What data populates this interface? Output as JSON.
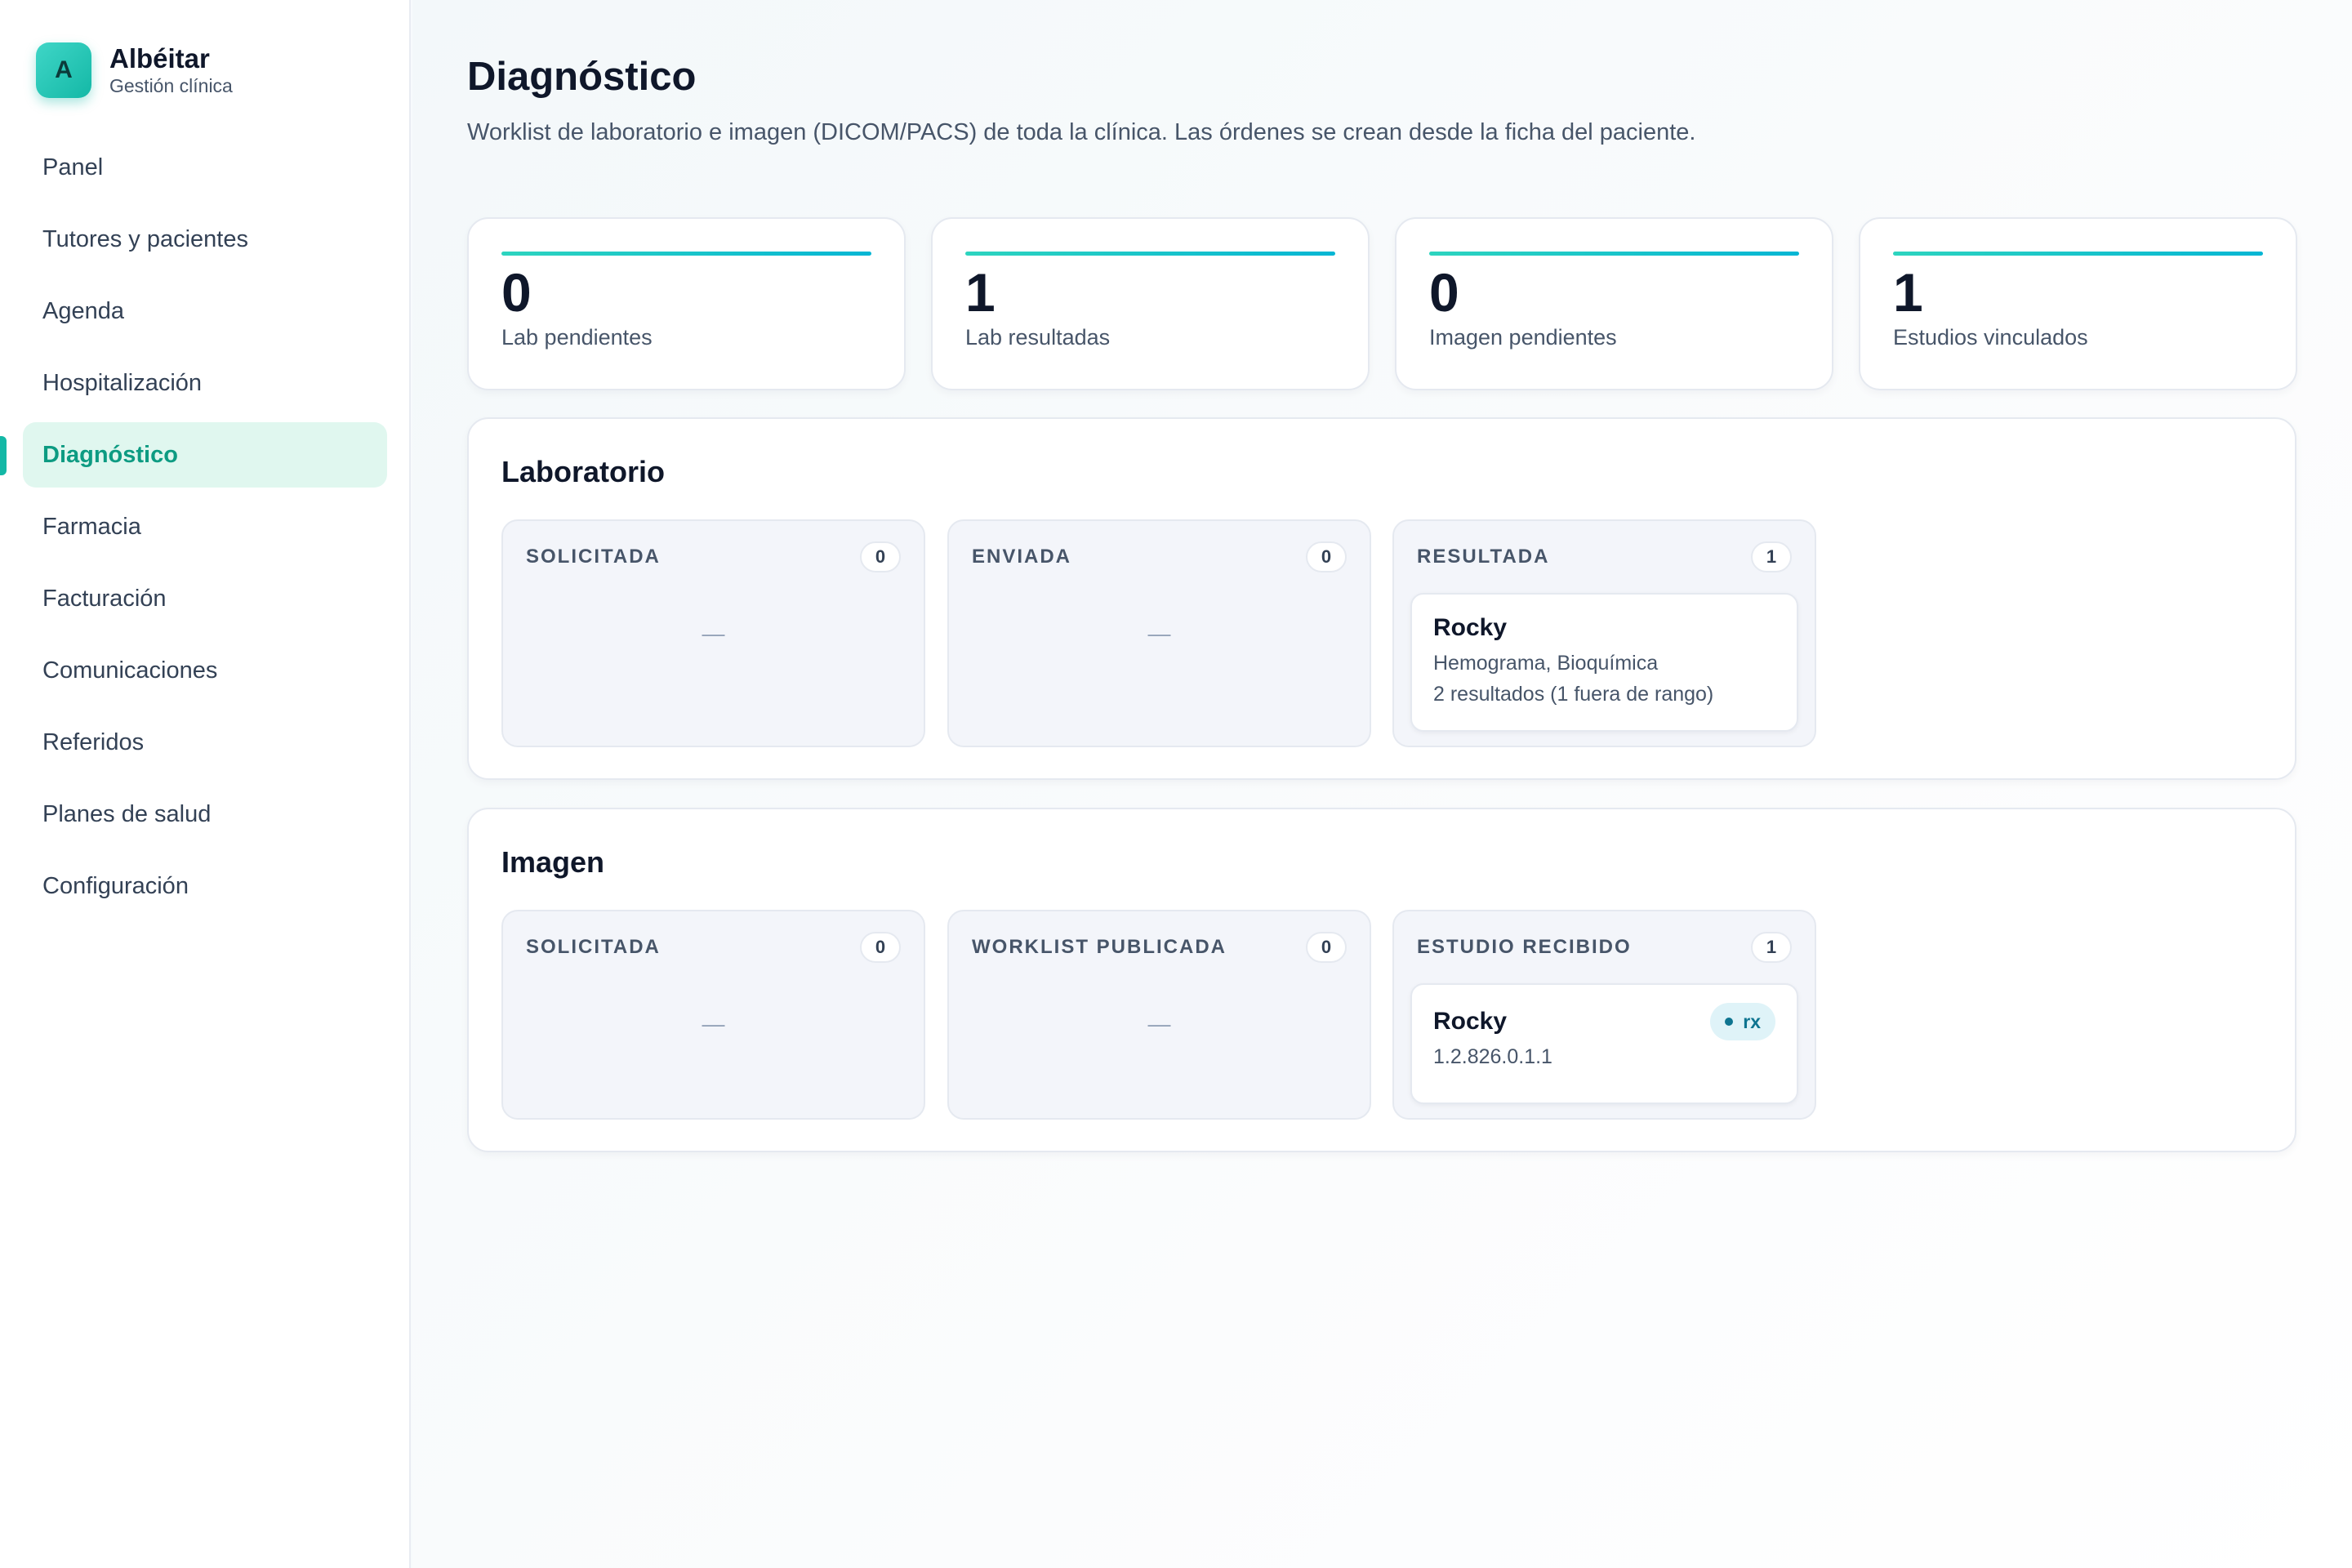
{
  "brand": {
    "logo_letter": "A",
    "name": "Albéitar",
    "subtitle": "Gestión clínica"
  },
  "nav": {
    "items": [
      {
        "label": "Panel"
      },
      {
        "label": "Tutores y pacientes"
      },
      {
        "label": "Agenda"
      },
      {
        "label": "Hospitalización"
      },
      {
        "label": "Diagnóstico",
        "active": true
      },
      {
        "label": "Farmacia"
      },
      {
        "label": "Facturación"
      },
      {
        "label": "Comunicaciones"
      },
      {
        "label": "Referidos"
      },
      {
        "label": "Planes de salud"
      },
      {
        "label": "Configuración"
      }
    ]
  },
  "page": {
    "title": "Diagnóstico",
    "description": "Worklist de laboratorio e imagen (DICOM/PACS) de toda la clínica. Las órdenes se crean desde la ficha del paciente."
  },
  "stats": [
    {
      "value": "0",
      "label": "Lab pendientes"
    },
    {
      "value": "1",
      "label": "Lab resultadas"
    },
    {
      "value": "0",
      "label": "Imagen pendientes"
    },
    {
      "value": "1",
      "label": "Estudios vinculados"
    }
  ],
  "lab": {
    "title": "Laboratorio",
    "columns": [
      {
        "title": "SOLICITADA",
        "count": "0",
        "empty": "—"
      },
      {
        "title": "ENVIADA",
        "count": "0",
        "empty": "—"
      },
      {
        "title": "RESULTADA",
        "count": "1",
        "card": {
          "name": "Rocky",
          "tests": "Hemograma, Bioquímica",
          "results": "2 resultados (1 fuera de rango)"
        }
      }
    ]
  },
  "imaging": {
    "title": "Imagen",
    "columns": [
      {
        "title": "SOLICITADA",
        "count": "0",
        "empty": "—"
      },
      {
        "title": "WORKLIST PUBLICADA",
        "count": "0",
        "empty": "—"
      },
      {
        "title": "ESTUDIO RECIBIDO",
        "count": "1",
        "card": {
          "name": "Rocky",
          "uid": "1.2.826.0.1.1",
          "modality": "rx"
        }
      }
    ]
  },
  "colors": {
    "accent": "#14b8a6",
    "active_bg": "#e0f7ef",
    "active_text": "#0d9b82",
    "tag_bg": "#dff3f8",
    "tag_text": "#0e7490"
  }
}
